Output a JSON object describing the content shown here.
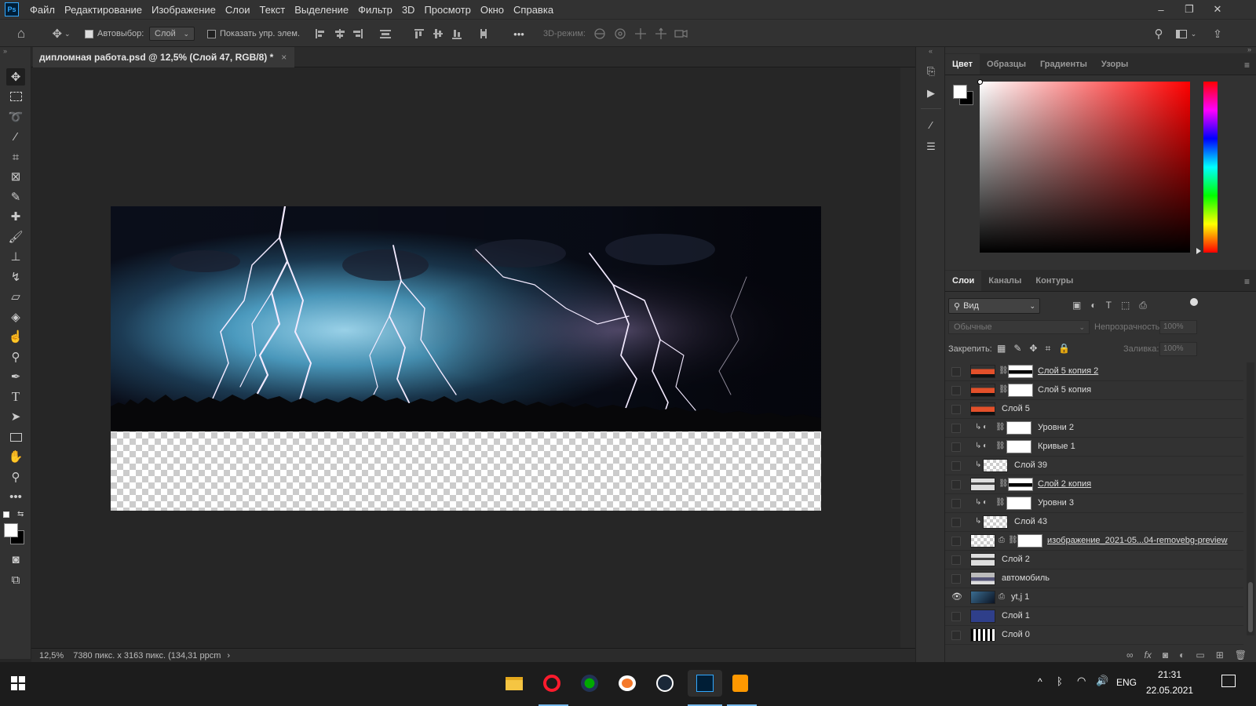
{
  "app": {
    "logo": "Ps"
  },
  "menu": [
    "Файл",
    "Редактирование",
    "Изображение",
    "Слои",
    "Текст",
    "Выделение",
    "Фильтр",
    "3D",
    "Просмотр",
    "Окно",
    "Справка"
  ],
  "window_controls": {
    "minimize": "‒",
    "restore": "❐",
    "close": "✕"
  },
  "options": {
    "autoselect_label": "Автовыбор:",
    "autoselect_checked": true,
    "autoselect_value": "Слой",
    "show_transform_label": "Показать упр. элем.",
    "show_transform_checked": false,
    "more": "•••",
    "mode3d_label": "3D-режим:"
  },
  "document": {
    "tab_title": "дипломная работа.psd @ 12,5% (Слой 47, RGB/8) *",
    "close": "×"
  },
  "status": {
    "zoom": "12,5%",
    "size": "7380 пикс. x 3163 пикс. (134,31 ppcm",
    "arrow": "›"
  },
  "color_panel": {
    "tabs": [
      "Цвет",
      "Образцы",
      "Градиенты",
      "Узоры"
    ],
    "active_tab": "Цвет",
    "foreground": "#ffffff",
    "background": "#000000",
    "picker_hue": "#ff0000"
  },
  "layers_panel": {
    "tabs": [
      "Слои",
      "Каналы",
      "Контуры"
    ],
    "active_tab": "Слои",
    "filter_label": "Вид",
    "blend_mode": "Обычные",
    "opacity_label": "Непрозрачность:",
    "opacity_value": "100%",
    "lock_label": "Закрепить:",
    "fill_label": "Заливка:",
    "fill_value": "100%",
    "layers": [
      {
        "name": "Слой 5 копия 2",
        "visible": false,
        "clipped": false,
        "thumb": "fire",
        "mask": "white-black",
        "adj": false,
        "underline": true
      },
      {
        "name": "Слой 5 копия",
        "visible": false,
        "clipped": false,
        "thumb": "fire",
        "mask": "white",
        "adj": false,
        "underline": false
      },
      {
        "name": "Слой 5",
        "visible": false,
        "clipped": false,
        "thumb": "fire",
        "mask": null,
        "adj": false,
        "underline": false
      },
      {
        "name": "Уровни 2",
        "visible": false,
        "clipped": true,
        "thumb": null,
        "mask": "white",
        "adj": true,
        "underline": false
      },
      {
        "name": "Кривые 1",
        "visible": false,
        "clipped": true,
        "thumb": null,
        "mask": "white",
        "adj": true,
        "underline": false
      },
      {
        "name": "Слой 39",
        "visible": false,
        "clipped": true,
        "thumb": "checker",
        "mask": null,
        "adj": false,
        "underline": false
      },
      {
        "name": "Слой 2 копия",
        "visible": false,
        "clipped": false,
        "thumb": "city",
        "mask": "white-black",
        "adj": false,
        "underline": true
      },
      {
        "name": "Уровни 3",
        "visible": false,
        "clipped": true,
        "thumb": null,
        "mask": "white",
        "adj": true,
        "underline": false
      },
      {
        "name": "Слой 43",
        "visible": false,
        "clipped": true,
        "thumb": "checker",
        "mask": null,
        "adj": false,
        "underline": false
      },
      {
        "name": "изображение_2021-05...04-removebg-preview",
        "visible": false,
        "clipped": false,
        "thumb": "checker",
        "mask": "white",
        "adj": false,
        "underline": true,
        "smart": true
      },
      {
        "name": "Слой 2",
        "visible": false,
        "clipped": false,
        "thumb": "city",
        "mask": null,
        "adj": false,
        "underline": false
      },
      {
        "name": "автомобиль",
        "visible": false,
        "clipped": false,
        "thumb": "car",
        "mask": null,
        "adj": false,
        "underline": false
      },
      {
        "name": "yt,j 1",
        "visible": true,
        "clipped": false,
        "thumb": "storm",
        "mask": null,
        "adj": false,
        "underline": false,
        "smart": true
      },
      {
        "name": "Слой 1",
        "visible": false,
        "clipped": false,
        "thumb": "blue",
        "mask": null,
        "adj": false,
        "underline": false
      },
      {
        "name": "Слой 0",
        "visible": false,
        "clipped": false,
        "thumb": "noise",
        "mask": null,
        "adj": false,
        "underline": false
      }
    ]
  },
  "taskbar": {
    "apps": [
      "file-explorer",
      "opera",
      "browser-green",
      "blender",
      "steam",
      "photoshop",
      "sublime-text"
    ],
    "active": [
      "opera",
      "photoshop",
      "sublime-text"
    ],
    "time": "21:31",
    "date": "22.05.2021",
    "lang": "ENG"
  }
}
